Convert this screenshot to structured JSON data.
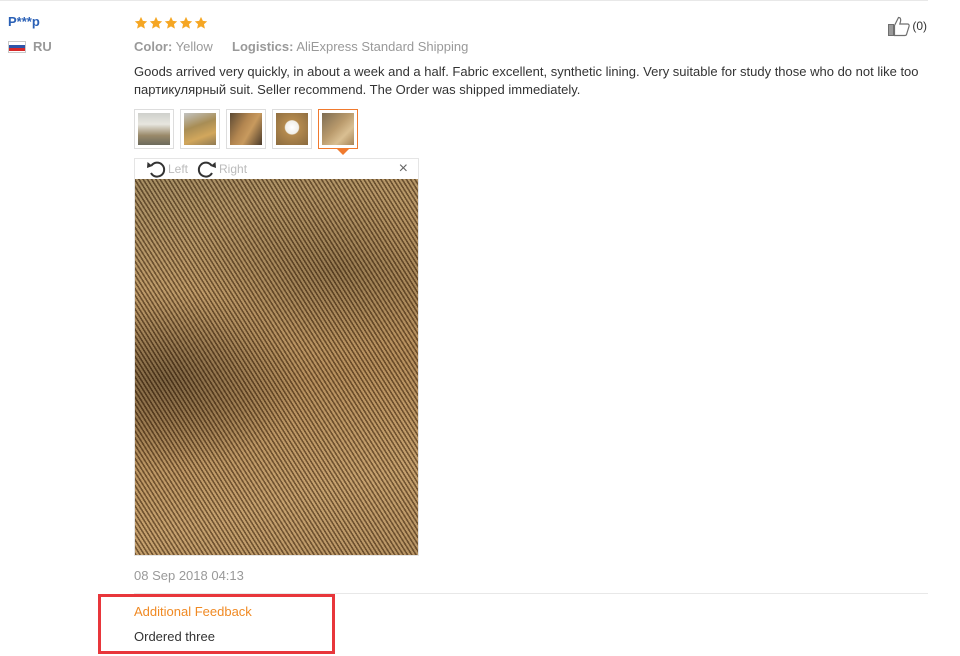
{
  "reviewer": {
    "name": "P***p",
    "country": "RU"
  },
  "rating": {
    "stars": 5,
    "max": 5,
    "color": "#f5a623"
  },
  "attributes": {
    "color_label": "Color:",
    "color_value": "Yellow",
    "logistics_label": "Logistics:",
    "logistics_value": "AliExpress Standard Shipping"
  },
  "review": {
    "text": "Goods arrived very quickly, in about a week and a half. Fabric excellent, synthetic lining. Very suitable for study those who do not like too партикулярный suit. Seller recommend. The Order was shipped immediately.",
    "date": "08 Sep 2018 04:13"
  },
  "photos": {
    "count": 5,
    "selected_index": 4
  },
  "viewer": {
    "rotate_left_label": "Left",
    "rotate_right_label": "Right",
    "close_label": "×"
  },
  "helpful": {
    "count_label": "(0)"
  },
  "additional_feedback": {
    "title": "Additional Feedback",
    "text": "Ordered three"
  },
  "colors": {
    "accent": "#f08a24",
    "link": "#2a60b6",
    "highlight_box": "#e8363b"
  }
}
